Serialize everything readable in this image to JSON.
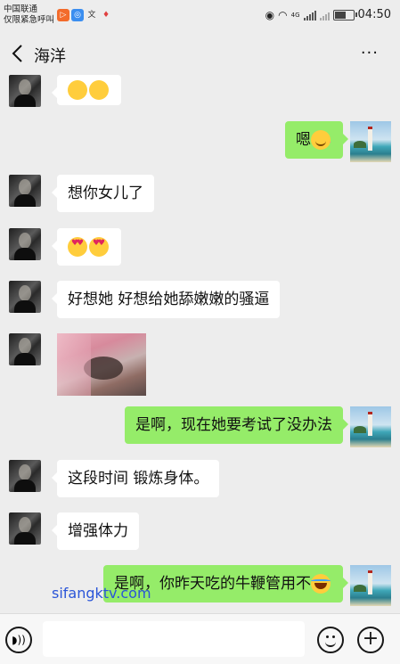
{
  "status_bar": {
    "carrier_line1": "中国联通",
    "carrier_line2": "仅限紧急呼叫",
    "time": "04:50",
    "network_label": "4G",
    "battery_level": 0.7,
    "app_icons": [
      "play-store-icon",
      "browser-icon",
      "duoyu-icon",
      "map-pin-icon"
    ]
  },
  "header": {
    "title": "海洋",
    "more_label": "···"
  },
  "messages": [
    {
      "side": "in",
      "type": "emoji",
      "emojis": [
        "flushed-face-icon",
        "flushed-face-icon"
      ]
    },
    {
      "side": "out",
      "type": "text",
      "text": "嗯",
      "emojis": [
        "smile-face-icon"
      ]
    },
    {
      "side": "in",
      "type": "text",
      "text": "想你女儿了"
    },
    {
      "side": "in",
      "type": "emoji",
      "emojis": [
        "heart-eyes-icon",
        "heart-eyes-icon"
      ]
    },
    {
      "side": "in",
      "type": "text",
      "text": "好想她 好想给她舔嫩嫩的骚逼"
    },
    {
      "side": "in",
      "type": "image"
    },
    {
      "side": "out",
      "type": "text",
      "text": "是啊，现在她要考试了没办法"
    },
    {
      "side": "in",
      "type": "text",
      "text": "这段时间 锻炼身体。"
    },
    {
      "side": "in",
      "type": "text",
      "text": "增强体力"
    },
    {
      "side": "out",
      "type": "text",
      "text": "是啊，你昨天吃的牛鞭管用不",
      "emojis": [
        "laugh-tears-icon"
      ]
    }
  ],
  "watermark": "sifangktv.com",
  "input_bar": {
    "placeholder": ""
  },
  "colors": {
    "background": "#ededed",
    "outgoing_bubble": "#95ec69",
    "incoming_bubble": "#ffffff",
    "watermark": "#2a55d8"
  }
}
